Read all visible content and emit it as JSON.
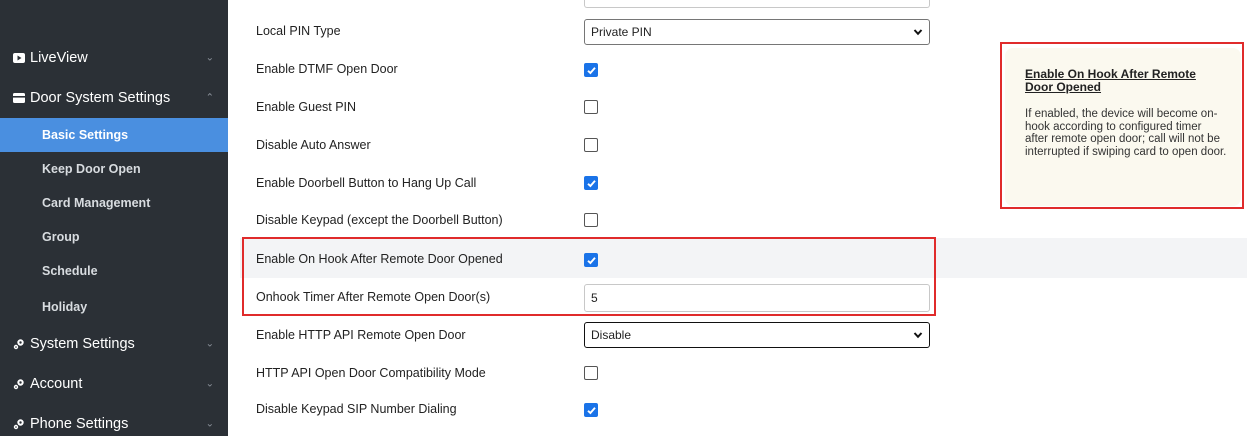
{
  "sidebar": {
    "items": [
      {
        "label": "LiveView",
        "icon": "play-icon"
      },
      {
        "label": "Door System Settings",
        "icon": "card-icon"
      }
    ],
    "subitems": [
      {
        "label": "Basic Settings",
        "active": true
      },
      {
        "label": "Keep Door Open"
      },
      {
        "label": "Card Management"
      },
      {
        "label": "Group"
      },
      {
        "label": "Schedule"
      },
      {
        "label": "Holiday"
      }
    ],
    "bottom_items": [
      {
        "label": "System Settings",
        "icon": "gear-icon"
      },
      {
        "label": "Account",
        "icon": "gear-icon"
      },
      {
        "label": "Phone Settings",
        "icon": "gear-icon"
      }
    ]
  },
  "settings": {
    "local_pin_type": {
      "label": "Local PIN Type",
      "value": "Private PIN"
    },
    "dtmf": {
      "label": "Enable DTMF Open Door",
      "checked": true
    },
    "guest_pin": {
      "label": "Enable Guest PIN",
      "checked": false
    },
    "auto_answer": {
      "label": "Disable Auto Answer",
      "checked": false
    },
    "doorbell_hangup": {
      "label": "Enable Doorbell Button to Hang Up Call",
      "checked": true
    },
    "disable_keypad": {
      "label": "Disable Keypad (except the Doorbell Button)",
      "checked": false
    },
    "onhook_after_remote": {
      "label": "Enable On Hook After Remote Door Opened",
      "checked": true
    },
    "onhook_timer": {
      "label": "Onhook Timer After Remote Open Door(s)",
      "value": "5"
    },
    "http_api": {
      "label": "Enable HTTP API Remote Open Door",
      "value": "Disable"
    },
    "http_compat": {
      "label": "HTTP API Open Door Compatibility Mode",
      "checked": false
    },
    "disable_sip_dialing": {
      "label": "Disable Keypad SIP Number Dialing",
      "checked": true
    }
  },
  "tooltip": {
    "title": "Enable On Hook After Remote Door Opened",
    "body": "If enabled, the device will become on-hook according to configured timer after remote open door; call will not be interrupted if swiping card to open door."
  },
  "colors": {
    "sidebar_bg": "#2b3036",
    "active_item": "#4a8fe0",
    "checkbox_on": "#1a73e8",
    "highlight_border": "#e02b2b",
    "tooltip_bg": "#fbf9ef"
  }
}
